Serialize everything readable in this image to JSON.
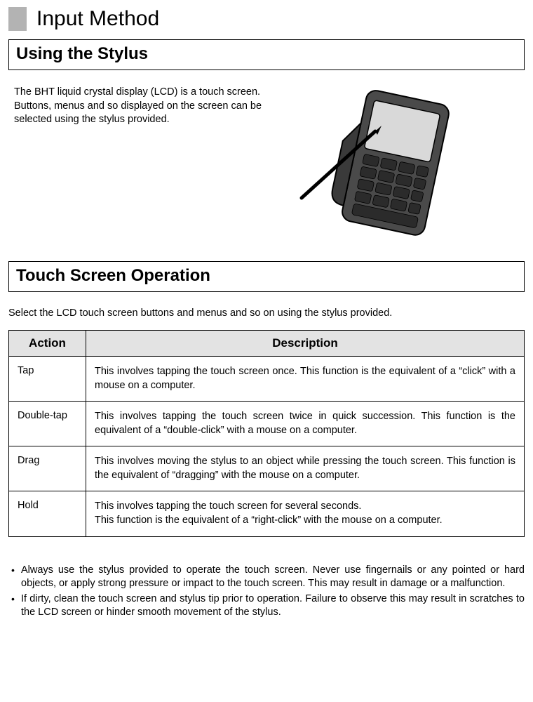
{
  "page": {
    "title": "Input Method"
  },
  "section1": {
    "heading": "Using the Stylus",
    "intro": "The BHT liquid crystal display (LCD) is a touch screen. Buttons, menus and so displayed on the screen can be selected using the stylus provided."
  },
  "section2": {
    "heading": "Touch Screen Operation",
    "intro": "Select the LCD touch screen buttons and menus and so on using the stylus provided.",
    "table": {
      "headers": {
        "action": "Action",
        "description": "Description"
      },
      "rows": [
        {
          "action": "Tap",
          "description": "This involves tapping the touch screen once. This function is the equivalent of a “click” with a mouse on a computer."
        },
        {
          "action": "Double-tap",
          "description": "This involves tapping the touch screen twice in quick succession. This function is the equivalent of a “double-click” with a mouse on a computer."
        },
        {
          "action": "Drag",
          "description": "This involves moving the stylus to an object while pressing the touch screen. This function is the equivalent of “dragging” with the mouse on a computer."
        },
        {
          "action": "Hold",
          "description": "This involves tapping the touch screen for several seconds.",
          "description2": "This function is the equivalent of a “right-click” with the mouse on a computer."
        }
      ]
    }
  },
  "notes": {
    "items": [
      "Always use the stylus provided to operate the touch screen. Never use fingernails or any pointed or hard objects, or apply strong pressure or impact to the touch screen. This may result in damage or a malfunction.",
      "If dirty, clean the touch screen and stylus tip prior to operation. Failure to observe this may result in scratches to the LCD screen or hinder smooth movement of the stylus."
    ]
  }
}
